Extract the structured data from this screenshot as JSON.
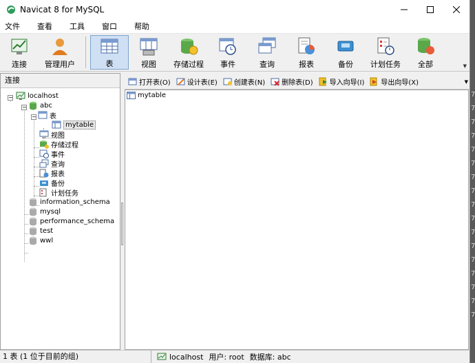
{
  "window": {
    "title": "Navicat 8 for MySQL"
  },
  "menu": [
    "文件",
    "查看",
    "工具",
    "窗口",
    "帮助"
  ],
  "toolbar": {
    "items": [
      {
        "label": "连接",
        "icon": "connect-icon"
      },
      {
        "label": "管理用户",
        "icon": "user-icon"
      },
      {
        "label": "表",
        "icon": "table-icon"
      },
      {
        "label": "视图",
        "icon": "view-icon"
      },
      {
        "label": "存储过程",
        "icon": "procedure-icon"
      },
      {
        "label": "事件",
        "icon": "event-icon"
      },
      {
        "label": "查询",
        "icon": "query-icon"
      },
      {
        "label": "报表",
        "icon": "report-icon"
      },
      {
        "label": "备份",
        "icon": "backup-icon"
      },
      {
        "label": "计划任务",
        "icon": "schedule-icon"
      },
      {
        "label": "全部",
        "icon": "all-icon"
      }
    ],
    "active": "表"
  },
  "left_panel": {
    "header": "连接",
    "tree": {
      "connection": "localhost",
      "database": "abc",
      "table_group": "表",
      "table": "mytable",
      "children": [
        "视图",
        "存储过程",
        "事件",
        "查询",
        "报表",
        "备份",
        "计划任务"
      ],
      "other_databases": [
        "information_schema",
        "mysql",
        "performance_schema",
        "test",
        "wwl"
      ]
    }
  },
  "object_toolbar": [
    {
      "label": "打开表(O)",
      "icon": "open-table-icon"
    },
    {
      "label": "设计表(E)",
      "icon": "design-table-icon"
    },
    {
      "label": "创建表(N)",
      "icon": "create-table-icon"
    },
    {
      "label": "删除表(D)",
      "icon": "delete-table-icon"
    },
    {
      "label": "导入向导(I)",
      "icon": "import-wizard-icon"
    },
    {
      "label": "导出向导(X)",
      "icon": "export-wizard-icon"
    }
  ],
  "objects": [
    "mytable"
  ],
  "status": {
    "left": "1 表 (1 位于目前的组)",
    "connection": "localhost",
    "user": "用户: root",
    "database": "数据库: abc"
  },
  "background_chars": [
    "7",
    "7",
    "7",
    "7",
    "7",
    "7",
    "7",
    "7",
    "7",
    "7",
    "7",
    "7",
    "7",
    "7",
    "7",
    "7",
    "7"
  ]
}
